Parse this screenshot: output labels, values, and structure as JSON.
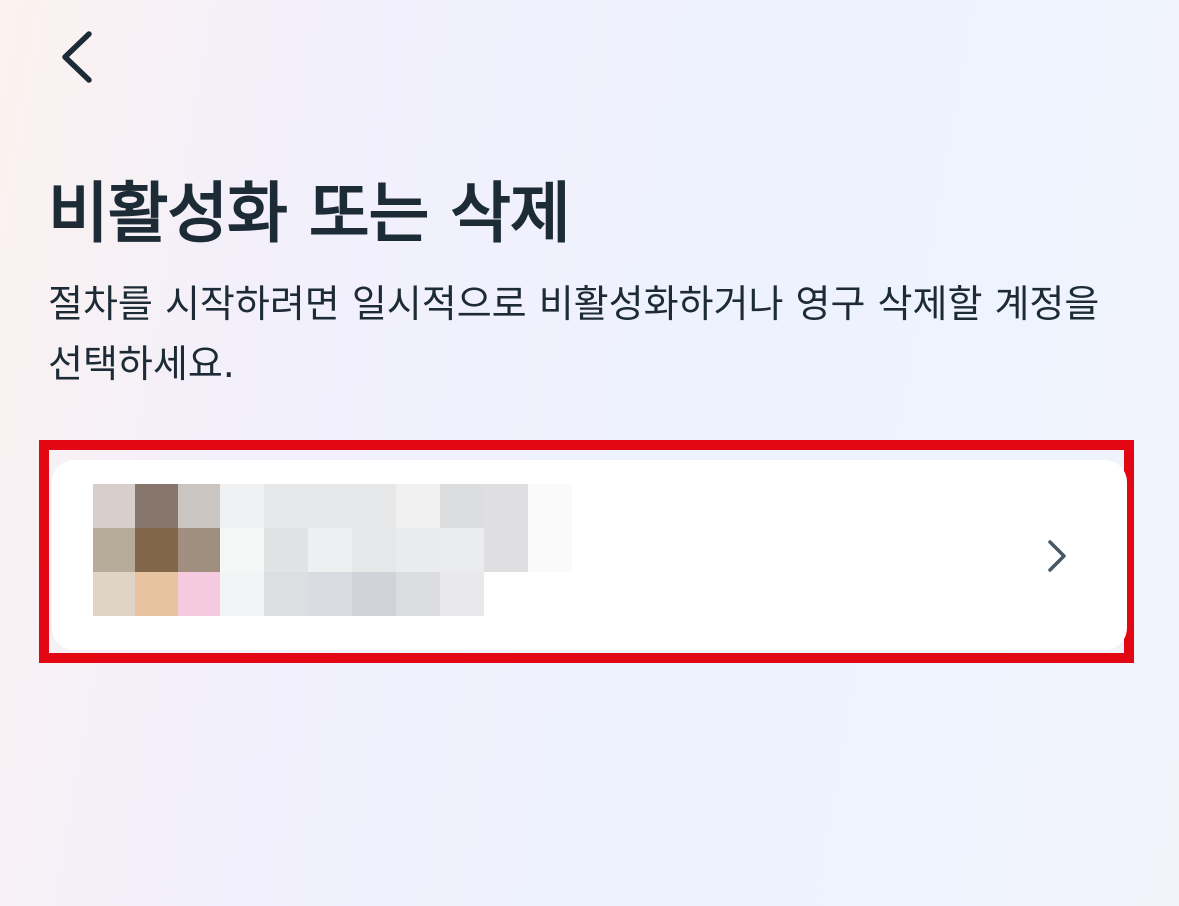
{
  "header": {
    "back_icon": "chevron-left-icon"
  },
  "title": "비활성화 또는 삭제",
  "description": "절차를 시작하려면 일시적으로 비활성화하거나 영구 삭제할 계정을 선택하세요.",
  "account_card": {
    "avatar_pixels": [
      "#d8cfcd",
      "#87766b",
      "#cac5c0",
      "#b7ab9a",
      "#82664a",
      "#a08f7e",
      "#e0d4c4",
      "#e7c39f",
      "#f5c9df"
    ],
    "name_pixels": [
      "#eff0f2",
      "#e6e7e9",
      "#e6e7e9",
      "#e6e7e9",
      "#eff0ef",
      "#dcdddf",
      "#dfdfe1",
      "#fafafa",
      "#f5f6f6",
      "#e1e2e4",
      "#eeeff1",
      "#e6e7e9",
      "#eaebed",
      "#ebecee",
      "#dfdfe1",
      "#fafafa",
      "#f2f3f4",
      "#dcdee1",
      "#d8dbdf",
      "#cfd3d7",
      "#dbdde0",
      "#e9e9eb",
      "#ffffff",
      "#ffffff"
    ],
    "chevron_icon": "chevron-right-icon"
  },
  "colors": {
    "highlight_border": "#e30613",
    "text": "#1c2b36",
    "icon": "#4a5864"
  }
}
